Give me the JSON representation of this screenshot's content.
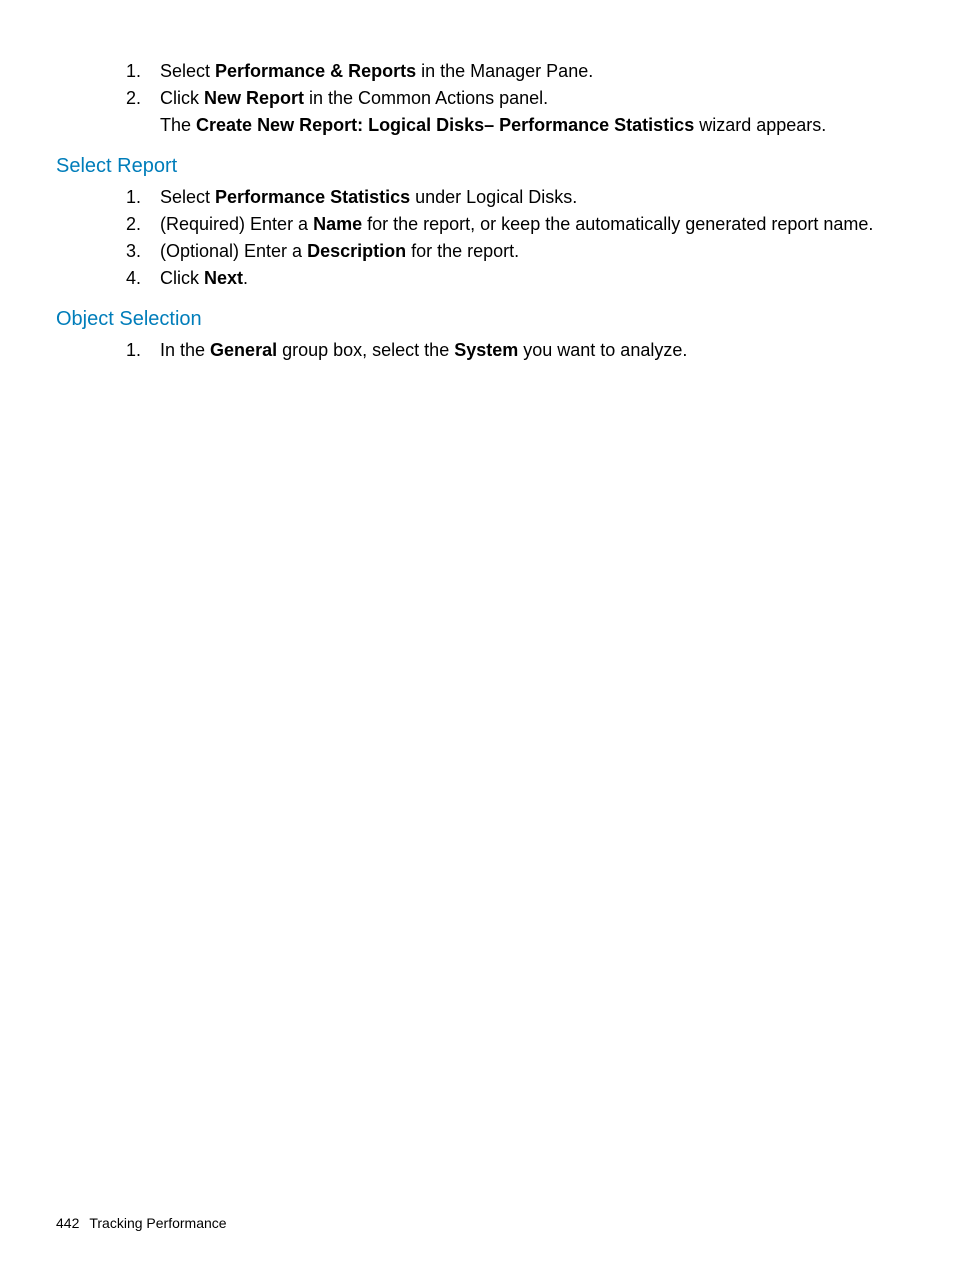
{
  "lists": {
    "top": [
      {
        "num": "1.",
        "pre": "Select ",
        "b": "Performance & Reports",
        "post": " in the Manager Pane."
      },
      {
        "num": "2.",
        "pre": "Click ",
        "b": "New Report",
        "post": " in the Common Actions panel."
      }
    ],
    "top_follow": {
      "pre": "The ",
      "b": "Create New Report: Logical Disks– Performance Statistics",
      "post": " wizard appears."
    },
    "select_report": [
      {
        "num": "1.",
        "pre": "Select ",
        "b": "Performance Statistics",
        "post": " under Logical Disks."
      },
      {
        "num": "2.",
        "pre": "(Required) Enter a ",
        "b": "Name",
        "post": " for the report, or keep the automatically generated report name."
      },
      {
        "num": "3.",
        "pre": "(Optional) Enter a ",
        "b": "Description",
        "post": " for the report."
      },
      {
        "num": "4.",
        "pre": "Click ",
        "b": "Next",
        "post": "."
      }
    ],
    "object_selection": [
      {
        "num": "1.",
        "pre": "In the ",
        "b": "General",
        "mid": " group box, select the ",
        "b2": "System",
        "post": " you want to analyze."
      }
    ]
  },
  "headings": {
    "select_report": "Select Report",
    "object_selection": "Object Selection"
  },
  "footer": {
    "page_number": "442",
    "title": "Tracking Performance"
  }
}
